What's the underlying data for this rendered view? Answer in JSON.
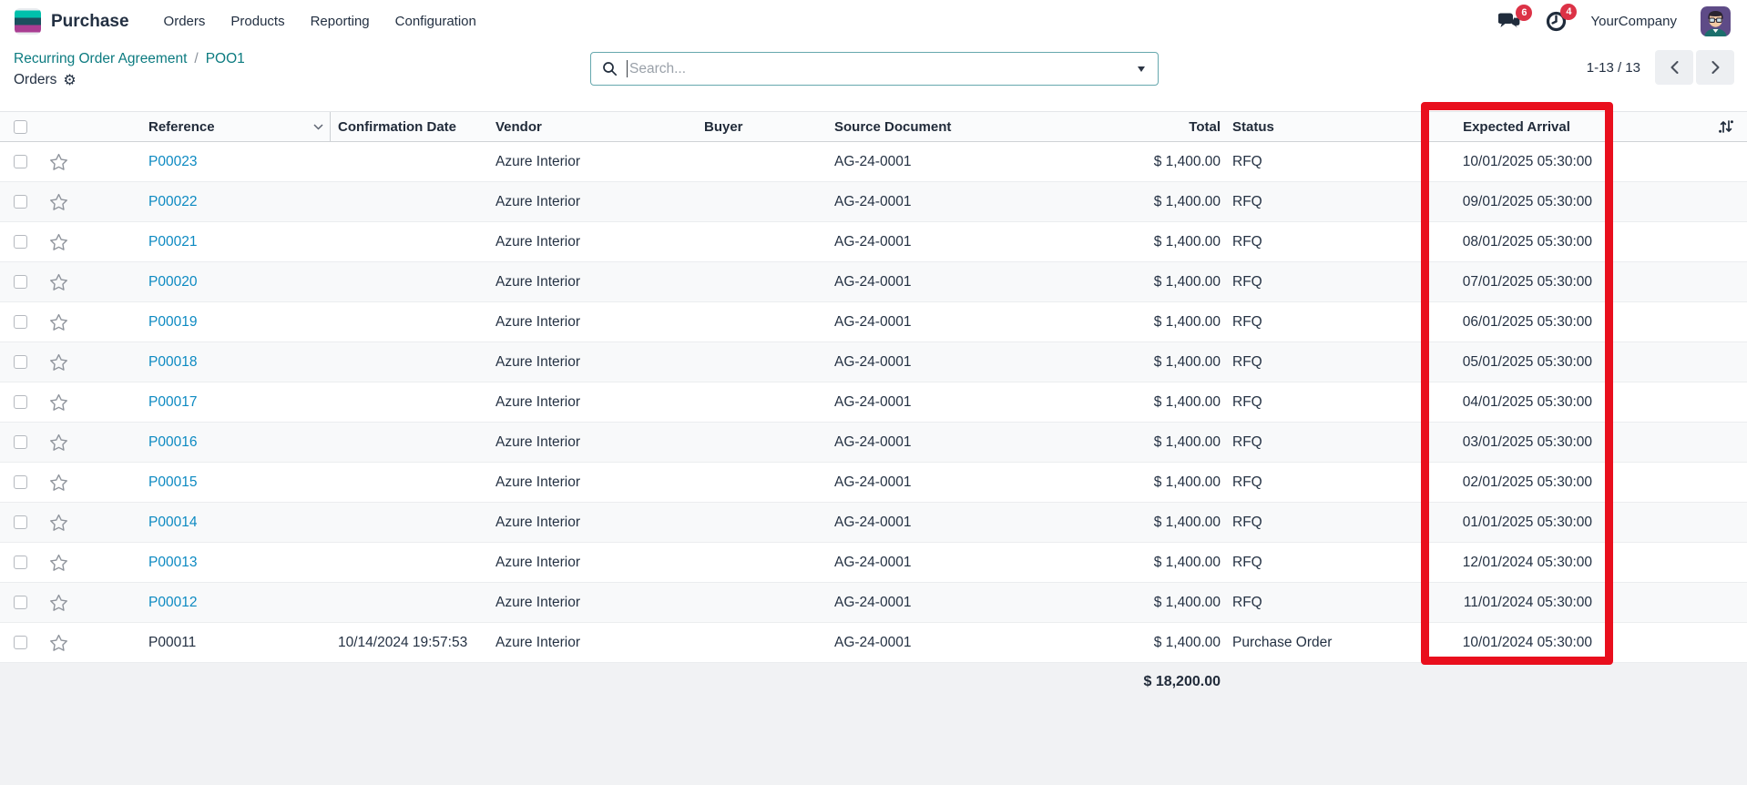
{
  "app": {
    "name": "Purchase"
  },
  "nav": {
    "items": [
      "Orders",
      "Products",
      "Reporting",
      "Configuration"
    ]
  },
  "topbar": {
    "messages_badge": "6",
    "activities_badge": "4",
    "company": "YourCompany"
  },
  "breadcrumb": {
    "parent": "Recurring Order Agreement",
    "separator": "/",
    "current": "POO1",
    "title": "Orders"
  },
  "icons": {
    "gear": "⚙"
  },
  "search": {
    "placeholder": "Search..."
  },
  "pager": {
    "range": "1-13 / 13"
  },
  "table": {
    "headers": {
      "reference": "Reference",
      "confirmation_date": "Confirmation Date",
      "vendor": "Vendor",
      "buyer": "Buyer",
      "source_document": "Source Document",
      "total": "Total",
      "status": "Status",
      "expected_arrival": "Expected Arrival"
    },
    "rows": [
      {
        "reference": "P00023",
        "is_link": true,
        "confirmation_date": "",
        "vendor": "Azure Interior",
        "buyer": "",
        "source_document": "AG-24-0001",
        "total": "$ 1,400.00",
        "status": "RFQ",
        "expected_arrival": "10/01/2025 05:30:00"
      },
      {
        "reference": "P00022",
        "is_link": true,
        "confirmation_date": "",
        "vendor": "Azure Interior",
        "buyer": "",
        "source_document": "AG-24-0001",
        "total": "$ 1,400.00",
        "status": "RFQ",
        "expected_arrival": "09/01/2025 05:30:00"
      },
      {
        "reference": "P00021",
        "is_link": true,
        "confirmation_date": "",
        "vendor": "Azure Interior",
        "buyer": "",
        "source_document": "AG-24-0001",
        "total": "$ 1,400.00",
        "status": "RFQ",
        "expected_arrival": "08/01/2025 05:30:00"
      },
      {
        "reference": "P00020",
        "is_link": true,
        "confirmation_date": "",
        "vendor": "Azure Interior",
        "buyer": "",
        "source_document": "AG-24-0001",
        "total": "$ 1,400.00",
        "status": "RFQ",
        "expected_arrival": "07/01/2025 05:30:00"
      },
      {
        "reference": "P00019",
        "is_link": true,
        "confirmation_date": "",
        "vendor": "Azure Interior",
        "buyer": "",
        "source_document": "AG-24-0001",
        "total": "$ 1,400.00",
        "status": "RFQ",
        "expected_arrival": "06/01/2025 05:30:00"
      },
      {
        "reference": "P00018",
        "is_link": true,
        "confirmation_date": "",
        "vendor": "Azure Interior",
        "buyer": "",
        "source_document": "AG-24-0001",
        "total": "$ 1,400.00",
        "status": "RFQ",
        "expected_arrival": "05/01/2025 05:30:00"
      },
      {
        "reference": "P00017",
        "is_link": true,
        "confirmation_date": "",
        "vendor": "Azure Interior",
        "buyer": "",
        "source_document": "AG-24-0001",
        "total": "$ 1,400.00",
        "status": "RFQ",
        "expected_arrival": "04/01/2025 05:30:00"
      },
      {
        "reference": "P00016",
        "is_link": true,
        "confirmation_date": "",
        "vendor": "Azure Interior",
        "buyer": "",
        "source_document": "AG-24-0001",
        "total": "$ 1,400.00",
        "status": "RFQ",
        "expected_arrival": "03/01/2025 05:30:00"
      },
      {
        "reference": "P00015",
        "is_link": true,
        "confirmation_date": "",
        "vendor": "Azure Interior",
        "buyer": "",
        "source_document": "AG-24-0001",
        "total": "$ 1,400.00",
        "status": "RFQ",
        "expected_arrival": "02/01/2025 05:30:00"
      },
      {
        "reference": "P00014",
        "is_link": true,
        "confirmation_date": "",
        "vendor": "Azure Interior",
        "buyer": "",
        "source_document": "AG-24-0001",
        "total": "$ 1,400.00",
        "status": "RFQ",
        "expected_arrival": "01/01/2025 05:30:00"
      },
      {
        "reference": "P00013",
        "is_link": true,
        "confirmation_date": "",
        "vendor": "Azure Interior",
        "buyer": "",
        "source_document": "AG-24-0001",
        "total": "$ 1,400.00",
        "status": "RFQ",
        "expected_arrival": "12/01/2024 05:30:00"
      },
      {
        "reference": "P00012",
        "is_link": true,
        "confirmation_date": "",
        "vendor": "Azure Interior",
        "buyer": "",
        "source_document": "AG-24-0001",
        "total": "$ 1,400.00",
        "status": "RFQ",
        "expected_arrival": "11/01/2024 05:30:00"
      },
      {
        "reference": "P00011",
        "is_link": false,
        "confirmation_date": "10/14/2024 19:57:53",
        "vendor": "Azure Interior",
        "buyer": "",
        "source_document": "AG-24-0001",
        "total": "$ 1,400.00",
        "status": "Purchase Order",
        "expected_arrival": "10/01/2024 05:30:00"
      }
    ],
    "footer_total": "$ 18,200.00"
  },
  "colors": {
    "highlight_red": "#e90f1d",
    "link_blue": "#0d8ac2",
    "breadcrumb_teal": "#0c7b80",
    "badge_red": "#dc3246"
  }
}
